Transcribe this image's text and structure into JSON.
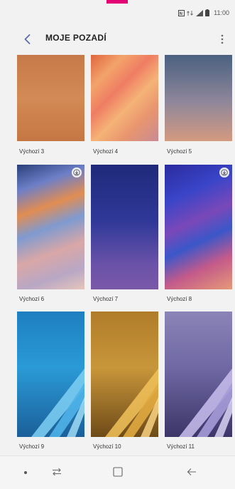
{
  "status_bar": {
    "time": "11:00"
  },
  "header": {
    "title": "MOJE POZADÍ"
  },
  "wallpapers": [
    {
      "label": "Výchozí 3"
    },
    {
      "label": "Výchozí 4"
    },
    {
      "label": "Výchozí 5"
    },
    {
      "label": "Výchozí 6",
      "downloadable": true
    },
    {
      "label": "Výchozí 7"
    },
    {
      "label": "Výchozí 8",
      "downloadable": true
    },
    {
      "label": "Výchozí 9"
    },
    {
      "label": "Výchozí 10"
    },
    {
      "label": "Výchozí 11"
    }
  ],
  "icons": {
    "back": "back-arrow-icon",
    "more": "more-vertical-icon",
    "download": "download-icon",
    "recent_apps": "recent-apps-icon",
    "home": "home-icon",
    "nav_back": "nav-back-icon"
  },
  "colors": {
    "accent": "#e20074",
    "title": "#222222"
  }
}
